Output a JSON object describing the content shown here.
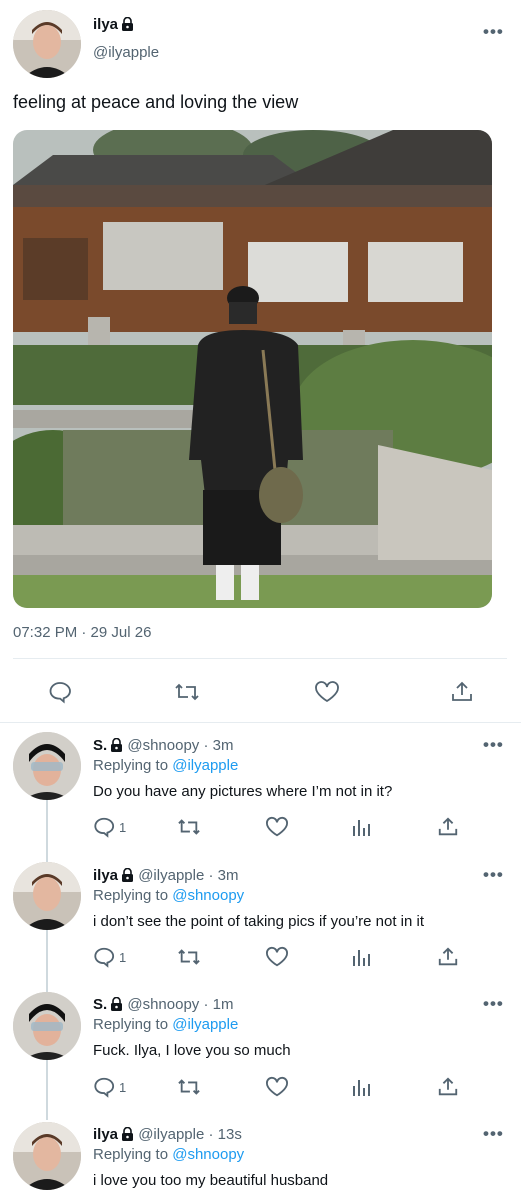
{
  "main_tweet": {
    "display_name": "ilya",
    "handle": "@ilyapple",
    "text": "feeling at peace and loving the view",
    "timestamp": "07:32 PM · 29 Jul 26",
    "more_icon": "…"
  },
  "actions": [
    "reply-icon",
    "retweet-icon",
    "like-icon",
    "share-icon"
  ],
  "replies": [
    {
      "display_name": "S.",
      "handle": "@shnoopy",
      "time": "· 3m",
      "replying_label": "Replying to",
      "replying_to": "@ilyapple",
      "text": "Do you have any pictures where I’m not in it?",
      "reply_count": "1"
    },
    {
      "display_name": "ilya",
      "handle": "@ilyapple",
      "time": "· 3m",
      "replying_label": "Replying to",
      "replying_to": "@shnoopy",
      "text": "i don’t see the point of taking pics if you’re not in it",
      "reply_count": "1"
    },
    {
      "display_name": "S.",
      "handle": "@shnoopy",
      "time": "· 1m",
      "replying_label": "Replying to",
      "replying_to": "@ilyapple",
      "text": "Fuck. Ilya, I love you so much",
      "reply_count": "1"
    },
    {
      "display_name": "ilya",
      "handle": "@ilyapple",
      "time": "· 13s",
      "replying_label": "Replying to",
      "replying_to": "@shnoopy",
      "text": "i love you too my beautiful husband",
      "reply_count": ""
    }
  ],
  "colors": {
    "accent": "#1d9bf0",
    "muted": "#536471",
    "divider": "#e6ecf0"
  }
}
